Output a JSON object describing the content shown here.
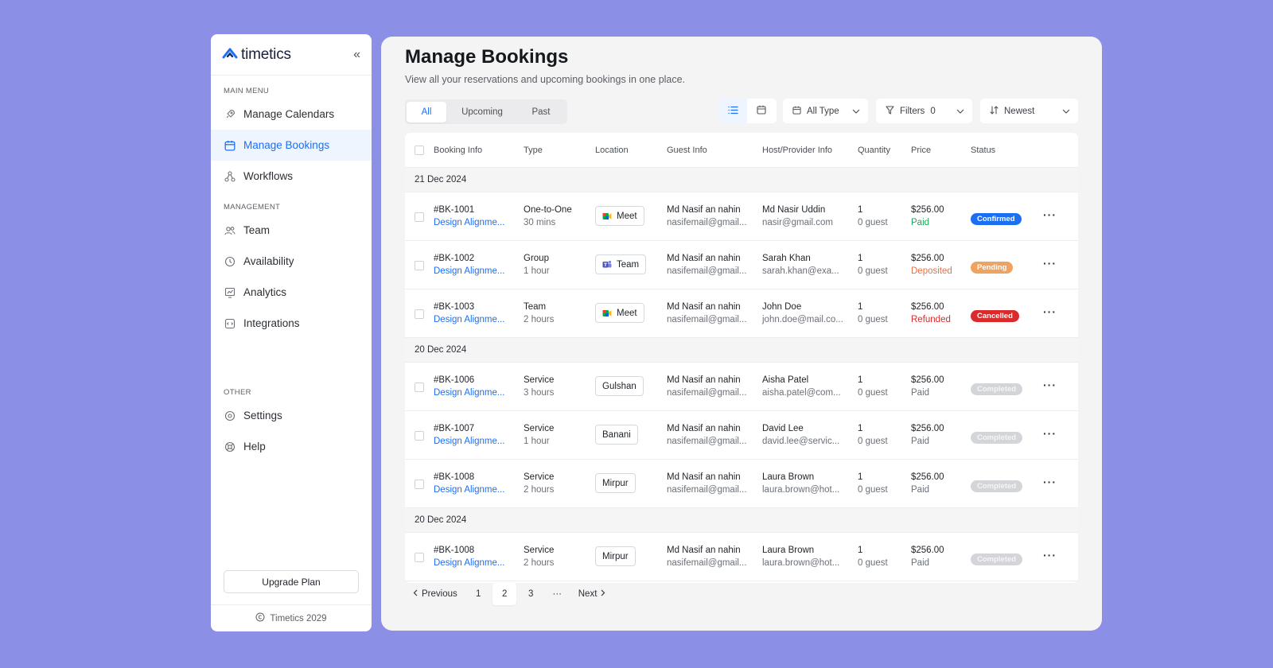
{
  "app": {
    "name": "timetics",
    "footer": "Timetics 2029"
  },
  "sidebar": {
    "sections": [
      {
        "title": "MAIN MENU",
        "items": [
          {
            "label": "Manage Calendars",
            "icon": "rocket-icon",
            "active": false
          },
          {
            "label": "Manage Bookings",
            "icon": "calendar-icon",
            "active": true
          },
          {
            "label": "Workflows",
            "icon": "workflow-icon",
            "active": false
          }
        ]
      },
      {
        "title": "MANAGEMENT",
        "items": [
          {
            "label": "Team",
            "icon": "users-icon",
            "active": false
          },
          {
            "label": "Availability",
            "icon": "clock-icon",
            "active": false
          },
          {
            "label": "Analytics",
            "icon": "chart-icon",
            "active": false
          },
          {
            "label": "Integrations",
            "icon": "plug-icon",
            "active": false
          }
        ]
      },
      {
        "title": "OTHER",
        "items": [
          {
            "label": "Settings",
            "icon": "gear-icon",
            "active": false
          },
          {
            "label": "Help",
            "icon": "help-icon",
            "active": false
          }
        ]
      }
    ],
    "upgrade_label": "Upgrade Plan"
  },
  "header": {
    "title": "Manage Bookings",
    "subtitle": "View all your reservations and upcoming bookings in one place."
  },
  "tabs": [
    {
      "label": "All",
      "active": true
    },
    {
      "label": "Upcoming",
      "active": false
    },
    {
      "label": "Past",
      "active": false
    }
  ],
  "controls": {
    "type_label": "All Type",
    "filters_label": "Filters",
    "filters_count": "0",
    "sort_label": "Newest"
  },
  "table": {
    "columns": [
      "Booking Info",
      "Type",
      "Location",
      "Guest Info",
      "Host/Provider Info",
      "Quantity",
      "Price",
      "Status"
    ],
    "groups": [
      {
        "date": "21 Dec 2024",
        "rows": [
          {
            "id": "#BK-1001",
            "title": "Design Alignme...",
            "type": "One-to-One",
            "duration": "30 mins",
            "location": "Meet",
            "loc_icon": "google-meet-icon",
            "guest_name": "Md Nasif an nahin",
            "guest_email": "nasifemail@gmail...",
            "host_name": "Md Nasir Uddin",
            "host_email": "nasir@gmail.com",
            "qty": "1",
            "guests": "0 guest",
            "price": "$256.00",
            "pay": "Paid",
            "pay_color": "#22a35a",
            "status": "Confirmed",
            "status_color": "#1d6ff2"
          },
          {
            "id": "#BK-1002",
            "title": "Design Alignme...",
            "type": "Group",
            "duration": "1 hour",
            "location": "Team",
            "loc_icon": "ms-teams-icon",
            "guest_name": "Md Nasif an nahin",
            "guest_email": "nasifemail@gmail...",
            "host_name": "Sarah Khan",
            "host_email": "sarah.khan@exa...",
            "qty": "1",
            "guests": "0 guest",
            "price": "$256.00",
            "pay": "Deposited",
            "pay_color": "#e0734a",
            "status": "Pending",
            "status_color": "#f0a35e"
          },
          {
            "id": "#BK-1003",
            "title": "Design Alignme...",
            "type": "Team",
            "duration": "2 hours",
            "location": "Meet",
            "loc_icon": "google-meet-icon",
            "guest_name": "Md Nasif an nahin",
            "guest_email": "nasifemail@gmail...",
            "host_name": "John Doe",
            "host_email": "john.doe@mail.co...",
            "qty": "1",
            "guests": "0 guest",
            "price": "$256.00",
            "pay": "Refunded",
            "pay_color": "#d92b2b",
            "status": "Cancelled",
            "status_color": "#d92b2b"
          }
        ]
      },
      {
        "date": "20 Dec 2024",
        "rows": [
          {
            "id": "#BK-1006",
            "title": "Design Alignme...",
            "type": "Service",
            "duration": "3 hours",
            "location": "Gulshan",
            "loc_icon": "",
            "guest_name": "Md Nasif an nahin",
            "guest_email": "nasifemail@gmail...",
            "host_name": "Aisha Patel",
            "host_email": "aisha.patel@com...",
            "qty": "1",
            "guests": "0 guest",
            "price": "$256.00",
            "pay": "Paid",
            "pay_color": "#6b7078",
            "status": "Completed",
            "status_color": "#d3d5d9"
          },
          {
            "id": "#BK-1007",
            "title": "Design Alignme...",
            "type": "Service",
            "duration": "1 hour",
            "location": "Banani",
            "loc_icon": "",
            "guest_name": "Md Nasif an nahin",
            "guest_email": "nasifemail@gmail...",
            "host_name": "David Lee",
            "host_email": "david.lee@servic...",
            "qty": "1",
            "guests": "0 guest",
            "price": "$256.00",
            "pay": "Paid",
            "pay_color": "#6b7078",
            "status": "Completed",
            "status_color": "#d3d5d9"
          },
          {
            "id": "#BK-1008",
            "title": "Design Alignme...",
            "type": "Service",
            "duration": "2 hours",
            "location": "Mirpur",
            "loc_icon": "",
            "guest_name": "Md Nasif an nahin",
            "guest_email": "nasifemail@gmail...",
            "host_name": "Laura Brown",
            "host_email": "laura.brown@hot...",
            "qty": "1",
            "guests": "0 guest",
            "price": "$256.00",
            "pay": "Paid",
            "pay_color": "#6b7078",
            "status": "Completed",
            "status_color": "#d3d5d9"
          }
        ]
      },
      {
        "date": "20 Dec 2024",
        "rows": [
          {
            "id": "#BK-1008",
            "title": "Design Alignme...",
            "type": "Service",
            "duration": "2 hours",
            "location": "Mirpur",
            "loc_icon": "",
            "guest_name": "Md Nasif an nahin",
            "guest_email": "nasifemail@gmail...",
            "host_name": "Laura Brown",
            "host_email": "laura.brown@hot...",
            "qty": "1",
            "guests": "0 guest",
            "price": "$256.00",
            "pay": "Paid",
            "pay_color": "#6b7078",
            "status": "Completed",
            "status_color": "#d3d5d9"
          }
        ]
      }
    ]
  },
  "pagination": {
    "prev_label": "Previous",
    "pages": [
      "1",
      "2",
      "3"
    ],
    "current": "2",
    "ellipsis": "···",
    "next_label": "Next"
  },
  "colors": {
    "accent": "#1d6ff2",
    "background": "#8b8fe6"
  }
}
